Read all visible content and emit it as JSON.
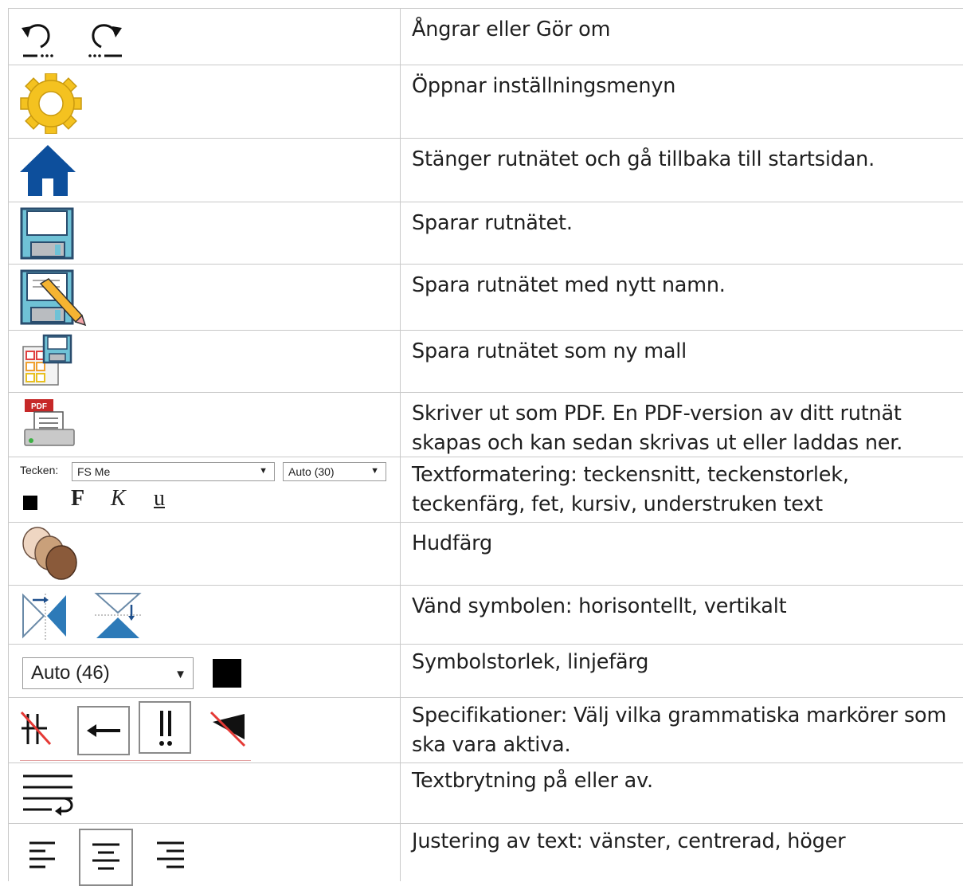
{
  "rows": [
    {
      "id": "undo-redo",
      "desc": "Ångrar eller Gör om"
    },
    {
      "id": "settings",
      "desc": "Öppnar inställningsmenyn"
    },
    {
      "id": "home",
      "desc": "Stänger rutnätet och gå tillbaka till startsidan."
    },
    {
      "id": "save",
      "desc": "Sparar rutnätet."
    },
    {
      "id": "save-as",
      "desc": "Spara rutnätet med nytt namn."
    },
    {
      "id": "save-template",
      "desc": "Spara rutnätet som ny mall"
    },
    {
      "id": "print-pdf",
      "desc": "Skriver ut som PDF. En PDF-version av ditt rutnät skapas och kan sedan skrivas ut eller laddas ner."
    },
    {
      "id": "text-format",
      "desc": "Textformatering: teckensnitt, teckenstorlek, teckenfärg, fet, kursiv, understruken text"
    },
    {
      "id": "skin-color",
      "desc": "Hudfärg"
    },
    {
      "id": "flip",
      "desc": "Vänd symbolen: horisontellt, vertikalt"
    },
    {
      "id": "symbol-size",
      "desc": "Symbolstorlek, linjefärg"
    },
    {
      "id": "specs",
      "desc": "Specifikationer: Välj vilka grammatiska markörer som ska vara aktiva."
    },
    {
      "id": "wrap",
      "desc": "Textbrytning på eller av."
    },
    {
      "id": "align",
      "desc": "Justering av text: vänster, centrerad, höger"
    }
  ],
  "pdf_badge": "PDF",
  "text_format": {
    "font_label": "Tecken:",
    "font_value": "FS Me",
    "size_value": "Auto (30)",
    "bold_label": "F",
    "italic_label": "K",
    "underline_label": "u"
  },
  "symbol_size": {
    "value": "Auto (46)"
  },
  "colors": {
    "skin_light": "#efd6c2",
    "skin_mid": "#c9a07a",
    "skin_dark": "#8a5a3a",
    "home_blue": "#0d4f9c",
    "gear_yellow": "#f4c220",
    "pdf_red": "#c62828"
  },
  "icons": [
    "undo-icon",
    "redo-icon",
    "gear-icon",
    "home-icon",
    "floppy-icon",
    "floppy-pencil-icon",
    "grid-floppy-icon",
    "printer-pdf-icon",
    "color-swatch-icon",
    "skin-color-icon",
    "flip-horizontal-icon",
    "flip-vertical-icon",
    "line-color-swatch-icon",
    "marker-plural-icon",
    "marker-arrow-icon",
    "marker-exclamation-icon",
    "marker-flag-icon",
    "text-wrap-icon",
    "align-left-icon",
    "align-center-icon",
    "align-right-icon"
  ]
}
